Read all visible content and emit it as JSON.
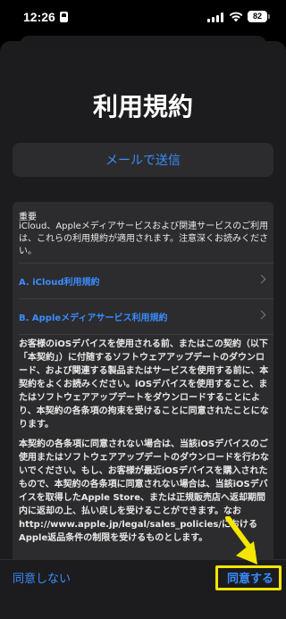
{
  "status_bar": {
    "time": "12:26",
    "battery": "82"
  },
  "title": "利用規約",
  "email_button": "メールで送信",
  "terms": {
    "heading": "重要",
    "intro": "iCloud、Appleメディアサービスおよび関連サービスのご利用は、これらの利用規約が適用されます。注意深くお読みください。",
    "links": [
      {
        "label": "A. iCloud利用規約"
      },
      {
        "label": "B. Appleメディアサービス利用規約"
      }
    ],
    "paragraph1": "お客様のiOSデバイスを使用される前、またはこの契約（以下「本契約」）に付随するソフトウェアアップデートのダウンロード、および関連する製品またはサービスを使用する前に、本契約をよくお読みください。iOSデバイスを使用すること、またはソフトウェアアップデートをダウンロードすることにより、本契約の各条項の拘束を受けることに同意されたことになります。",
    "paragraph2": "本契約の各条項に同意されない場合は、当該iOSデバイスのご使用またはソフトウェアアップデートのダウンロードを行わないでください。もし、お客様が最近iOSデバイスを購入されたもので、本契約の各条項に同意されない場合は、当該iOSデバイスを取得したApple Store、または正規販売店へ返却期間内に返却の上、払い戻しを受けることができます。なお http://www.apple.jp/legal/sales_policies/における Apple返品条件の制限を受けるものとします。"
  },
  "bottom_bar": {
    "disagree": "同意しない",
    "agree": "同意する"
  },
  "colors": {
    "accent": "#3a8cff",
    "highlight": "#f5e600",
    "background": "#1c1c1e"
  },
  "icons": [
    "id-icon",
    "signal-icon",
    "wifi-icon",
    "battery-icon",
    "chevron-icon",
    "arrow-icon"
  ]
}
